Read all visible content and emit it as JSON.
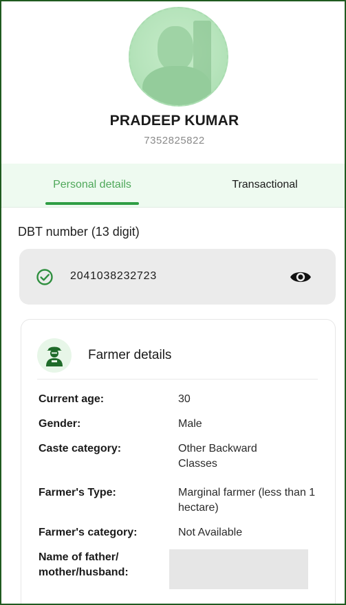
{
  "profile": {
    "name": "PRADEEP KUMAR",
    "phone": "7352825822"
  },
  "tabs": [
    {
      "label": "Personal details",
      "active": true
    },
    {
      "label": "Transactional",
      "active": false
    }
  ],
  "dbt": {
    "label": "DBT number (13 digit)",
    "value": "2041038232723",
    "verified_icon": "check-circle-icon",
    "toggle_icon": "eye-icon"
  },
  "farmer_details": {
    "title": "Farmer details",
    "icon": "farmer-icon",
    "rows": [
      {
        "label": "Current age:",
        "value": "30"
      },
      {
        "label": "Gender:",
        "value": "Male"
      },
      {
        "label": "Caste category:",
        "value": "Other Backward Classes"
      },
      {
        "label": "Farmer's Type:",
        "value": "Marginal farmer (less than 1 hectare)"
      },
      {
        "label": "Farmer's category:",
        "value": "Not Available"
      },
      {
        "label": "Name of father/ mother/husband:",
        "value": ""
      }
    ]
  },
  "colors": {
    "accent": "#2f9e44",
    "tab_active_text": "#4fa85a",
    "tab_bg": "#eefaf0",
    "frame_border": "#1f5a1f"
  }
}
